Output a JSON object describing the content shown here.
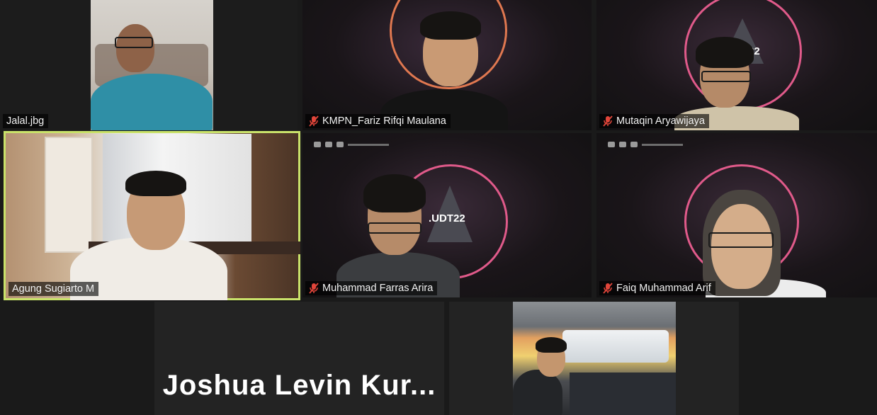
{
  "participants": [
    {
      "name": "Jalal.jbg",
      "muted": false
    },
    {
      "name": "KMPN_Fariz Rifqi Maulana",
      "muted": true
    },
    {
      "name": "Mutaqin Aryawijaya",
      "muted": true
    },
    {
      "name": "Agung Sugiarto M",
      "muted": false,
      "active_speaker": true
    },
    {
      "name": "Muhammad Farras Arira",
      "muted": true,
      "background_text": ".UDT22"
    },
    {
      "name": "Faiq Muhammad Arif",
      "muted": true
    },
    {
      "name": "Joshua Levin Kur...",
      "video_off": true
    },
    {
      "name": "",
      "muted": false
    }
  ],
  "background_logo_text": "22",
  "colors": {
    "active_speaker_border": "#c9e26a",
    "muted_icon": "#e0453a",
    "ring_pink": "#e05a8a",
    "ring_orange": "#e0703a"
  },
  "icons": {
    "muted": "mic-off-icon"
  }
}
